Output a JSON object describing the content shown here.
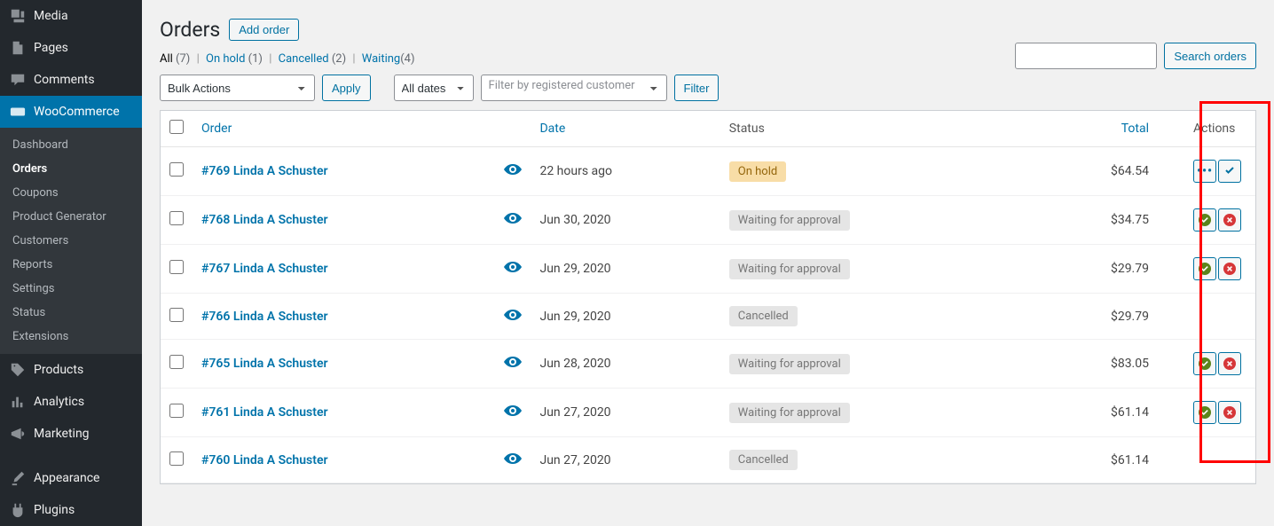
{
  "sidebar": {
    "items": [
      {
        "label": "Media",
        "icon": "media"
      },
      {
        "label": "Pages",
        "icon": "page"
      },
      {
        "label": "Comments",
        "icon": "comment"
      },
      {
        "label": "WooCommerce",
        "icon": "woo",
        "active": true
      },
      {
        "label": "Products",
        "icon": "tag"
      },
      {
        "label": "Analytics",
        "icon": "analytics"
      },
      {
        "label": "Marketing",
        "icon": "megaphone"
      },
      {
        "label": "Appearance",
        "icon": "brush"
      },
      {
        "label": "Plugins",
        "icon": "plugin"
      }
    ],
    "submenu": [
      {
        "label": "Dashboard"
      },
      {
        "label": "Orders",
        "current": true
      },
      {
        "label": "Coupons"
      },
      {
        "label": "Product Generator"
      },
      {
        "label": "Customers"
      },
      {
        "label": "Reports"
      },
      {
        "label": "Settings"
      },
      {
        "label": "Status"
      },
      {
        "label": "Extensions"
      }
    ]
  },
  "page": {
    "title": "Orders",
    "add_button": "Add order"
  },
  "filters": {
    "all_label": "All",
    "all_count": "(7)",
    "onhold_label": "On hold",
    "onhold_count": "(1)",
    "cancelled_label": "Cancelled",
    "cancelled_count": "(2)",
    "waiting_label": "Waiting",
    "waiting_count": "(4)"
  },
  "controls": {
    "bulk_actions": "Bulk Actions",
    "apply": "Apply",
    "all_dates": "All dates",
    "filter_customer_placeholder": "Filter by registered customer",
    "filter": "Filter",
    "search_button": "Search orders"
  },
  "table": {
    "headers": {
      "order": "Order",
      "date": "Date",
      "status": "Status",
      "total": "Total",
      "actions": "Actions"
    },
    "rows": [
      {
        "order": "#769 Linda A Schuster",
        "date": "22 hours ago",
        "status": "On hold",
        "status_class": "onhold",
        "total": "$64.54",
        "actions": "onhold"
      },
      {
        "order": "#768 Linda A Schuster",
        "date": "Jun 30, 2020",
        "status": "Waiting for approval",
        "status_class": "waiting",
        "total": "$34.75",
        "actions": "approve"
      },
      {
        "order": "#767 Linda A Schuster",
        "date": "Jun 29, 2020",
        "status": "Waiting for approval",
        "status_class": "waiting",
        "total": "$29.79",
        "actions": "approve"
      },
      {
        "order": "#766 Linda A Schuster",
        "date": "Jun 29, 2020",
        "status": "Cancelled",
        "status_class": "cancelled",
        "total": "$29.79",
        "actions": "none"
      },
      {
        "order": "#765 Linda A Schuster",
        "date": "Jun 28, 2020",
        "status": "Waiting for approval",
        "status_class": "waiting",
        "total": "$83.05",
        "actions": "approve"
      },
      {
        "order": "#761 Linda A Schuster",
        "date": "Jun 27, 2020",
        "status": "Waiting for approval",
        "status_class": "waiting",
        "total": "$61.14",
        "actions": "approve"
      },
      {
        "order": "#760 Linda A Schuster",
        "date": "Jun 27, 2020",
        "status": "Cancelled",
        "status_class": "cancelled",
        "total": "$61.14",
        "actions": "none"
      }
    ]
  }
}
